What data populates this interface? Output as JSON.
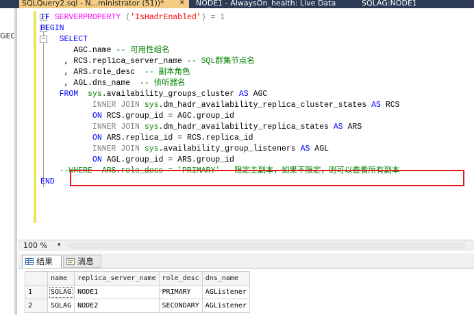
{
  "tabs": [
    {
      "label": "SQLQuery2.sql - N...ministrator (51))*",
      "close": "✕",
      "active": true
    },
    {
      "label": "NODE1 - AlwaysOn_health: Live Data",
      "active": false
    },
    {
      "label": "SQLAG:NODE1",
      "active": false
    }
  ],
  "explorer": {
    "partial_label": "GEO"
  },
  "editor": {
    "lines": [
      [
        {
          "t": "IF ",
          "c": "kw"
        },
        {
          "t": "SERVERPROPERTY",
          "c": "fn"
        },
        {
          "t": " (",
          "c": "gray"
        },
        {
          "t": "'IsHadrEnabled'",
          "c": "str"
        },
        {
          "t": ") = 1",
          "c": "gray"
        }
      ],
      [
        {
          "t": "BEGIN",
          "c": "kw"
        }
      ],
      [
        {
          "t": "    SELECT",
          "c": "kw"
        }
      ],
      [
        {
          "t": "       AGC.name ",
          "c": ""
        },
        {
          "t": "-- 可用性组名",
          "c": "cmt"
        }
      ],
      [
        {
          "t": "     , RCS.replica_server_name ",
          "c": ""
        },
        {
          "t": "-- SQL群集节点名",
          "c": "cmt"
        }
      ],
      [
        {
          "t": "     , ARS.role_desc  ",
          "c": ""
        },
        {
          "t": "-- 副本角色",
          "c": "cmt"
        }
      ],
      [
        {
          "t": "     , AGL.dns_name  ",
          "c": ""
        },
        {
          "t": "-- 侦听器名",
          "c": "cmt"
        }
      ],
      [
        {
          "t": "    FROM ",
          "c": "kw"
        },
        {
          "t": " sys",
          "c": "sys"
        },
        {
          "t": ".availability_groups_cluster ",
          "c": ""
        },
        {
          "t": "AS",
          "c": "kw"
        },
        {
          "t": " AGC",
          "c": ""
        }
      ],
      [
        {
          "t": "           INNER JOIN ",
          "c": "gray"
        },
        {
          "t": "sys",
          "c": "sys"
        },
        {
          "t": ".dm_hadr_availability_replica_cluster_states ",
          "c": ""
        },
        {
          "t": "AS",
          "c": "kw"
        },
        {
          "t": " RCS",
          "c": ""
        }
      ],
      [
        {
          "t": "           ON ",
          "c": "kw"
        },
        {
          "t": "RCS.group_id = AGC.group_id",
          "c": ""
        }
      ],
      [
        {
          "t": "           INNER JOIN ",
          "c": "gray"
        },
        {
          "t": "sys",
          "c": "sys"
        },
        {
          "t": ".dm_hadr_availability_replica_states ",
          "c": ""
        },
        {
          "t": "AS",
          "c": "kw"
        },
        {
          "t": " ARS",
          "c": ""
        }
      ],
      [
        {
          "t": "           ON ",
          "c": "kw"
        },
        {
          "t": "ARS.replica_id = RCS.replica_id",
          "c": ""
        }
      ],
      [
        {
          "t": "           INNER JOIN ",
          "c": "gray"
        },
        {
          "t": "sys",
          "c": "sys"
        },
        {
          "t": ".availability_group_listeners ",
          "c": ""
        },
        {
          "t": "AS",
          "c": "kw"
        },
        {
          "t": " AGL",
          "c": ""
        }
      ],
      [
        {
          "t": "           ON ",
          "c": "kw"
        },
        {
          "t": "AGL.group_id = ARS.group_id",
          "c": ""
        }
      ],
      [
        {
          "t": "    --WHERE  ARS.role_desc = 'PRIMARY' --限定主副本，如果不限定，则可以查看所有副本",
          "c": "cmt"
        }
      ],
      [
        {
          "t": "END",
          "c": "kw"
        }
      ]
    ]
  },
  "zoombar": {
    "zoom": "100 %",
    "arrow": "▾"
  },
  "results": {
    "tabs": [
      {
        "label": "结果",
        "active": true
      },
      {
        "label": "消息",
        "active": false
      }
    ],
    "columns": [
      "name",
      "replica_server_name",
      "role_desc",
      "dns_name"
    ],
    "rows": [
      {
        "num": "1",
        "cells": [
          "SQLAG",
          "NODE1",
          "PRIMARY",
          "AGListener"
        ]
      },
      {
        "num": "2",
        "cells": [
          "SQLAG",
          "NODE2",
          "SECONDARY",
          "AGListener"
        ]
      }
    ]
  }
}
